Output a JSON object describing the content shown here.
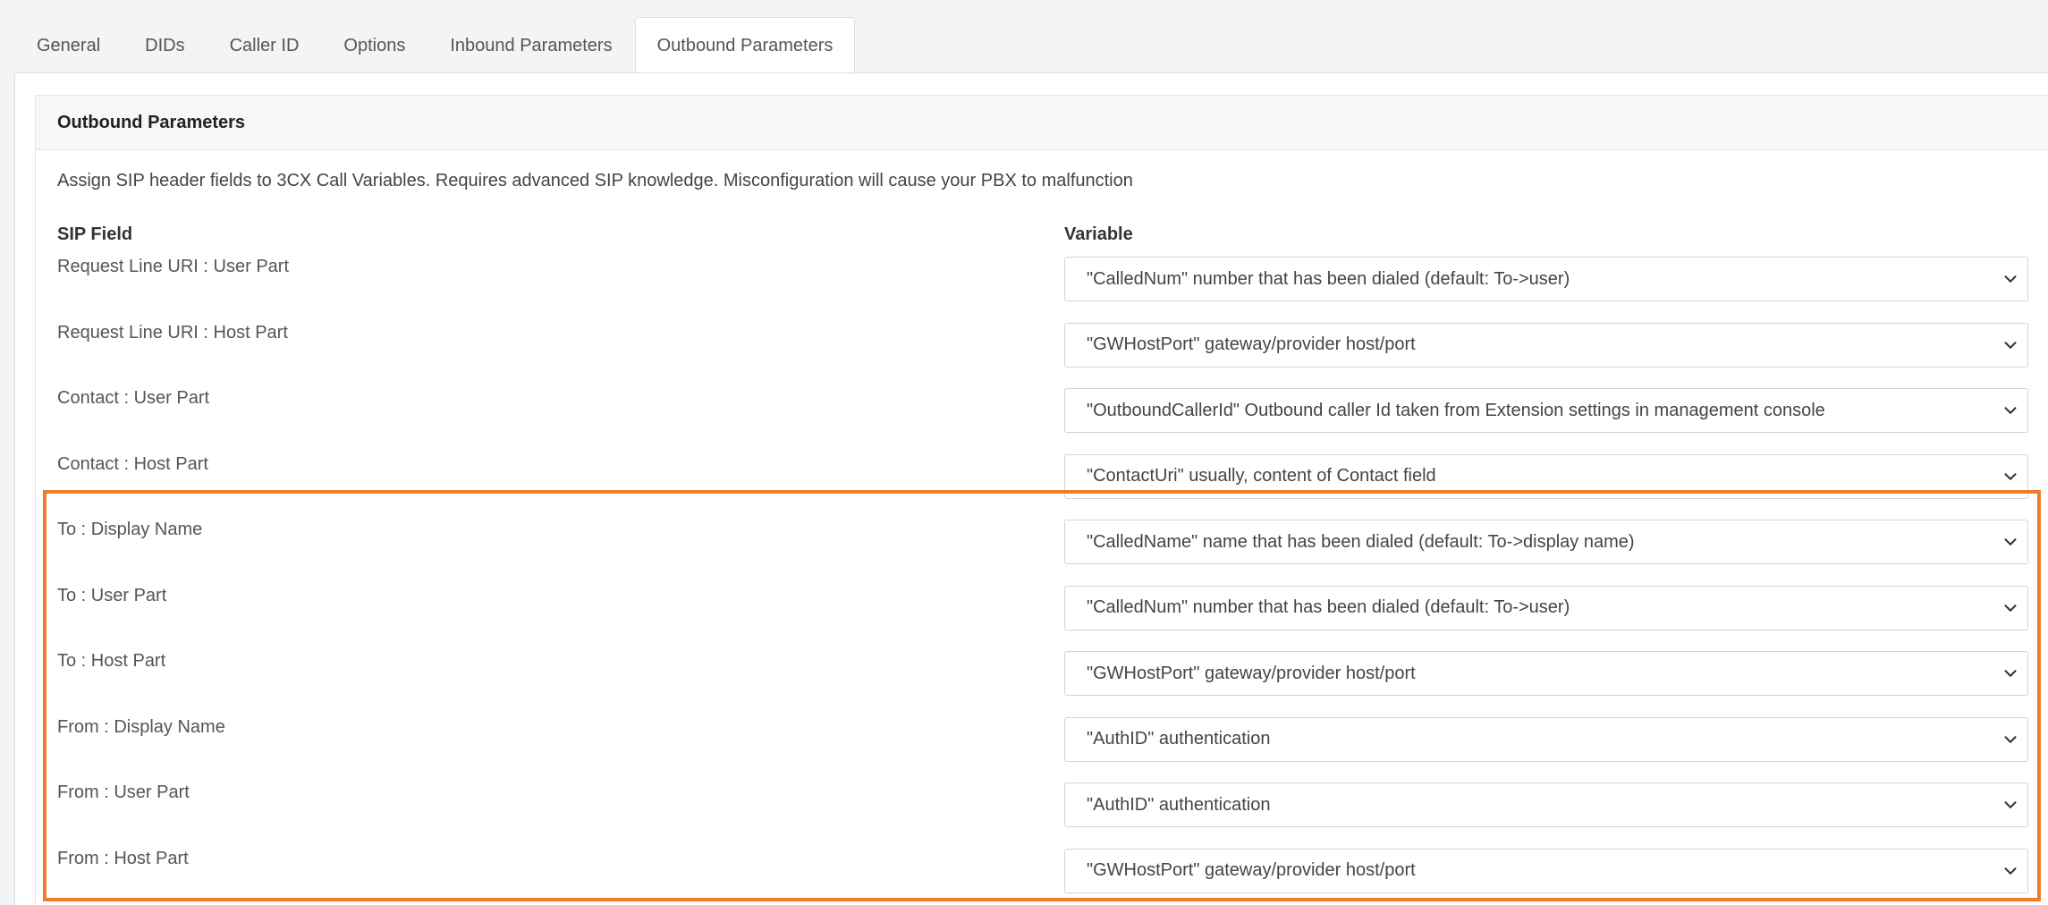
{
  "tabs": [
    "General",
    "DIDs",
    "Caller ID",
    "Options",
    "Inbound Parameters",
    "Outbound Parameters"
  ],
  "active_tab": "Outbound Parameters",
  "card": {
    "title": "Outbound Parameters",
    "description": "Assign SIP header fields to 3CX Call Variables. Requires advanced SIP knowledge. Misconfiguration will cause your PBX to malfunction",
    "col_sip_field": "SIP Field",
    "col_variable": "Variable"
  },
  "rows": [
    {
      "field": "Request Line URI : User Part",
      "variable": "\"CalledNum\" number that has been dialed (default: To->user)"
    },
    {
      "field": "Request Line URI : Host Part",
      "variable": "\"GWHostPort\" gateway/provider host/port"
    },
    {
      "field": "Contact : User Part",
      "variable": "\"OutboundCallerId\" Outbound caller Id taken from Extension settings in management console"
    },
    {
      "field": "Contact : Host Part",
      "variable": "\"ContactUri\" usually, content of Contact field"
    },
    {
      "field": "To : Display Name",
      "variable": "\"CalledName\" name that has been dialed (default: To->display name)"
    },
    {
      "field": "To : User Part",
      "variable": "\"CalledNum\" number that has been dialed (default: To->user)"
    },
    {
      "field": "To : Host Part",
      "variable": "\"GWHostPort\" gateway/provider host/port"
    },
    {
      "field": "From : Display Name",
      "variable": "\"AuthID\" authentication"
    },
    {
      "field": "From : User Part",
      "variable": "\"AuthID\" authentication"
    },
    {
      "field": "From : Host Part",
      "variable": "\"GWHostPort\" gateway/provider host/port"
    }
  ],
  "colors": {
    "highlight": "#f07d2a",
    "panel_bg": "#ffffff",
    "page_bg": "#f2f4f5"
  },
  "icons": {
    "select_arrow": "chevron-down-icon"
  }
}
